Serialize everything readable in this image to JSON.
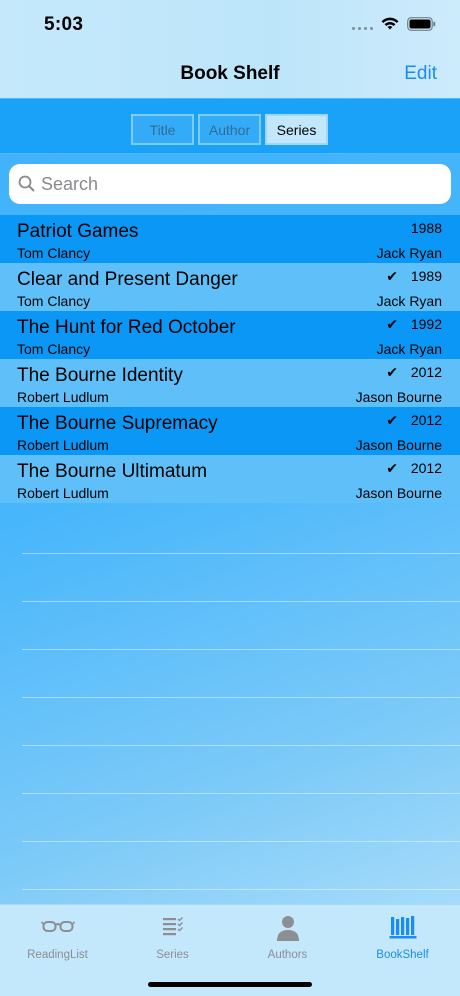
{
  "status": {
    "time": "5:03"
  },
  "nav": {
    "title": "Book Shelf",
    "edit_label": "Edit"
  },
  "segments": [
    {
      "label": "Title",
      "selected": false
    },
    {
      "label": "Author",
      "selected": false
    },
    {
      "label": "Series",
      "selected": true
    }
  ],
  "search": {
    "placeholder": "Search",
    "value": ""
  },
  "books": [
    {
      "title": "Patriot Games",
      "author": "Tom Clancy",
      "series": "Jack Ryan",
      "year": "1988",
      "read": false,
      "check": ""
    },
    {
      "title": "Clear and Present Danger",
      "author": "Tom Clancy",
      "series": "Jack Ryan",
      "year": "1989",
      "read": true,
      "check": "✔"
    },
    {
      "title": "The Hunt for Red October",
      "author": "Tom Clancy",
      "series": "Jack Ryan",
      "year": "1992",
      "read": true,
      "check": "✔"
    },
    {
      "title": "The Bourne Identity",
      "author": "Robert Ludlum",
      "series": "Jason Bourne",
      "year": "2012",
      "read": true,
      "check": "✔"
    },
    {
      "title": "The Bourne Supremacy",
      "author": "Robert Ludlum",
      "series": "Jason Bourne",
      "year": "2012",
      "read": true,
      "check": "✔"
    },
    {
      "title": "The Bourne Ultimatum",
      "author": "Robert Ludlum",
      "series": "Jason Bourne",
      "year": "2012",
      "read": true,
      "check": "✔"
    }
  ],
  "tabs": [
    {
      "label": "ReadingList",
      "icon": "glasses-icon",
      "active": false
    },
    {
      "label": "Series",
      "icon": "checklist-icon",
      "active": false
    },
    {
      "label": "Authors",
      "icon": "person-icon",
      "active": false
    },
    {
      "label": "BookShelf",
      "icon": "bookshelf-icon",
      "active": true
    }
  ],
  "colors": {
    "accent": "#1a8cf4",
    "row_dark": "#0b97f5",
    "row_light": "#5fc0f9",
    "segment_bar": "#1aa2f8"
  }
}
